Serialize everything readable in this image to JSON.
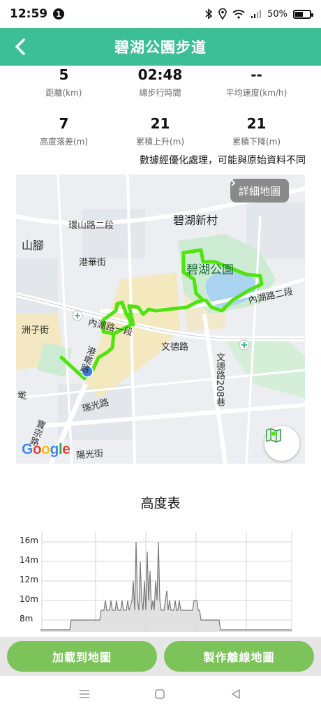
{
  "status_bar": {
    "time": "12:59",
    "notification_count": "1",
    "battery": "50%"
  },
  "header": {
    "title": "碧湖公園步道"
  },
  "stats": [
    {
      "value": "5",
      "label": "距離(km)"
    },
    {
      "value": "02:48",
      "label": "總步行時間"
    },
    {
      "value": "--",
      "label": "平均速度(km/h)"
    },
    {
      "value": "7",
      "label": "高度落差(m)"
    },
    {
      "value": "21",
      "label": "累積上升(m)"
    },
    {
      "value": "21",
      "label": "累積下降(m)"
    }
  ],
  "note": "數據經優化處理，可能與原始資料不同",
  "map": {
    "detail_button": "詳細地圖",
    "labels": {
      "bihu_village": "碧湖新村",
      "bihu_park": "碧湖公園",
      "huanshan_rd": "環山路二段",
      "shanjiao": "山腳",
      "ganghua_st": "港華街",
      "neihu_rd_right": "內湖路二段",
      "neihu_rd_left": "內湖路一段",
      "wende_rd": "文德路",
      "zhouzi_st": "洲子街",
      "wende_208": "文德路208巷",
      "ruiguang_rd": "瑞光路",
      "gangqian_rd": "港墘路",
      "yangguang_st": "陽光街",
      "puzong_rd": "寶宗路",
      "kan": "墘"
    },
    "google": [
      "G",
      "o",
      "o",
      "g",
      "l",
      "e"
    ],
    "route_color": "#4ee40e"
  },
  "elevation": {
    "title": "高度表",
    "y_labels": [
      "16m",
      "14m",
      "12m",
      "10m",
      "8m"
    ],
    "y_values": [
      16,
      14,
      12,
      10,
      8
    ]
  },
  "buttons": {
    "load_to_map": "加載到地圖",
    "make_offline_map": "製作離線地圖"
  },
  "colors": {
    "header": "#3cbf94",
    "button": "#7cc35a"
  }
}
